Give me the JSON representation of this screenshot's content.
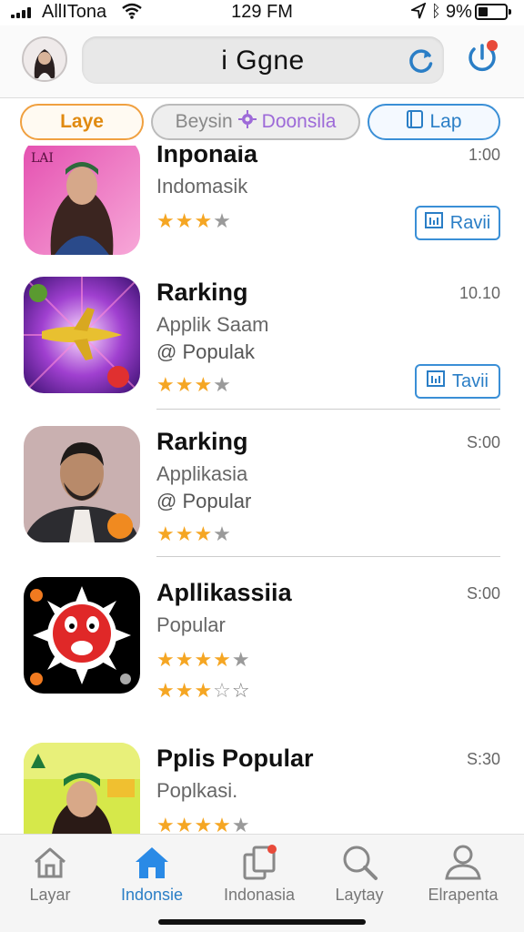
{
  "status_bar": {
    "carrier": "AllITona",
    "time": "129 FM",
    "battery": "9%"
  },
  "header": {
    "title": "i Ggne"
  },
  "filters": [
    {
      "label": "Laye"
    },
    {
      "label": "Beysin",
      "label2": "Doonsila"
    },
    {
      "label": "Lap"
    }
  ],
  "apps": [
    {
      "title": "Inponaia",
      "sub1": "Indomasik",
      "sub2": "",
      "time": "1:00",
      "rating": 3,
      "action": "Ravii"
    },
    {
      "title": "Rarking",
      "sub1": "Applik Saam",
      "sub2": "@ Populak",
      "time": "10.10",
      "rating": 3,
      "action": "Tavii"
    },
    {
      "title": "Rarking",
      "sub1": "Applikasia",
      "sub2": "@ Popular",
      "time": "S:00",
      "rating": 3,
      "action": ""
    },
    {
      "title": "Apllikassiia",
      "sub1": "Popular",
      "sub2": "",
      "time": "S:00",
      "rating": 4,
      "rating2": 3.5,
      "action": ""
    },
    {
      "title": "Pplis Popular",
      "sub1": "Poplkasi.",
      "sub2": "",
      "time": "S:30",
      "rating": 4,
      "action": ""
    }
  ],
  "thumb_text": {
    "app1_corner": "LAI"
  },
  "tabbar": [
    {
      "label": "Layar",
      "icon": "home-outline-icon",
      "active": false
    },
    {
      "label": "Indonsie",
      "icon": "home-filled-icon",
      "active": true
    },
    {
      "label": "Indonasia",
      "icon": "apps-notification-icon",
      "active": false
    },
    {
      "label": "Laytay",
      "icon": "search-icon",
      "active": false
    },
    {
      "label": "Elrapenta",
      "icon": "person-icon",
      "active": false
    }
  ],
  "colors": {
    "accent": "#2a7ec6",
    "star": "#f5a623",
    "orange_pill": "#f0a040"
  }
}
